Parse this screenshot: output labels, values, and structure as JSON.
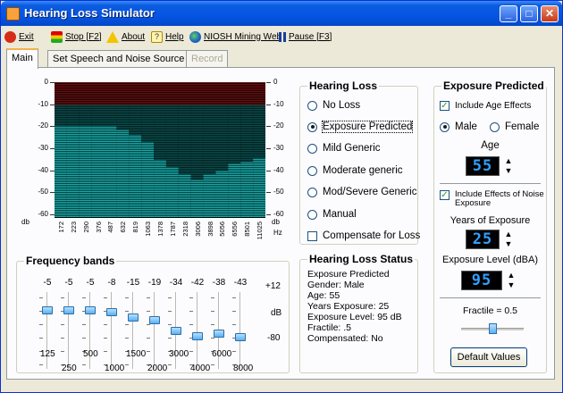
{
  "window": {
    "title": "Hearing Loss Simulator"
  },
  "menu": [
    {
      "label": "Exit",
      "icon": "exit-icon"
    },
    {
      "label": "Stop [F2]",
      "icon": "stop-light-icon"
    },
    {
      "label": "About",
      "icon": "warning-icon"
    },
    {
      "label": "Help",
      "icon": "help-icon"
    },
    {
      "label": "NIOSH Mining Web",
      "icon": "globe-icon"
    },
    {
      "label": "Pause [F3]",
      "icon": "pause-icon"
    }
  ],
  "tabs": [
    {
      "label": "Main",
      "state": "active"
    },
    {
      "label": "Set Speech and Noise Source",
      "state": "normal"
    },
    {
      "label": "Record",
      "state": "disabled"
    }
  ],
  "spectrogram": {
    "y_left_ticks": [
      "0",
      "-10",
      "-20",
      "-30",
      "-40",
      "-50",
      "-60"
    ],
    "y_right_ticks": [
      "0",
      "-10",
      "-20",
      "-30",
      "-40",
      "-50",
      "-60"
    ],
    "y_left_unit": "db",
    "y_right_unit": "db",
    "x_unit": "Hz",
    "x_ticks": [
      "172",
      "223",
      "290",
      "376",
      "487",
      "632",
      "819",
      "1063",
      "1378",
      "1787",
      "2318",
      "3006",
      "3898",
      "5056",
      "6556",
      "8501",
      "11025"
    ],
    "loss_per_band_db": [
      20,
      20,
      20,
      20,
      20,
      21,
      24,
      27,
      35,
      38,
      42,
      44,
      42,
      40,
      37,
      36,
      34
    ],
    "colors": {
      "background": "#000000",
      "red_band": "#701010",
      "dark_cyan": "#0c5a5a",
      "bright_cyan": "#1cc4c4"
    }
  },
  "frequency_bands": {
    "title": "Frequency bands",
    "values": [
      "-5",
      "-5",
      "-5",
      "-8",
      "-15",
      "-19",
      "-34",
      "-42",
      "-38",
      "-43"
    ],
    "levels_db": [
      -5,
      -5,
      -5,
      -8,
      -15,
      -19,
      -34,
      -42,
      -38,
      -43
    ],
    "range_db": [
      -80,
      12
    ],
    "scale_top": "+12",
    "scale_mid": "dB",
    "scale_bottom": "-80",
    "freq_row1": [
      "125",
      "500",
      "1500",
      "3000",
      "6000"
    ],
    "freq_row2": [
      "250",
      "1000",
      "2000",
      "4000",
      "8000"
    ]
  },
  "hearing_loss": {
    "title": "Hearing Loss",
    "options": [
      {
        "label": "No Loss",
        "selected": false
      },
      {
        "label": "Exposure Predicted",
        "selected": true
      },
      {
        "label": "Mild Generic",
        "selected": false
      },
      {
        "label": "Moderate generic",
        "selected": false
      },
      {
        "label": "Mod/Severe Generic",
        "selected": false
      },
      {
        "label": "Manual",
        "selected": false
      }
    ],
    "compensate_label": "Compensate for Loss",
    "compensate_checked": false
  },
  "status": {
    "title": "Hearing Loss Status",
    "lines": [
      "Exposure Predicted",
      "Gender: Male",
      "Age: 55",
      "Years Exposure: 25",
      "Exposure Level: 95 dB",
      "Fractile: .5",
      "Compensated: No"
    ]
  },
  "exposure": {
    "title": "Exposure Predicted",
    "include_age_label": "Include Age Effects",
    "include_age_checked": true,
    "male_label": "Male",
    "female_label": "Female",
    "gender": "Male",
    "age_label": "Age",
    "age_value": "55",
    "include_noise_label_1": "Include Effects of Noise",
    "include_noise_label_2": "Exposure",
    "include_noise_checked": true,
    "years_label": "Years of Exposure",
    "years_value": "25",
    "level_label": "Exposure Level (dBA)",
    "level_value": "95",
    "fractile_label": "Fractile = 0.5",
    "fractile_value": 0.5,
    "default_button": "Default Values",
    "led_color": "#30a0ff"
  }
}
